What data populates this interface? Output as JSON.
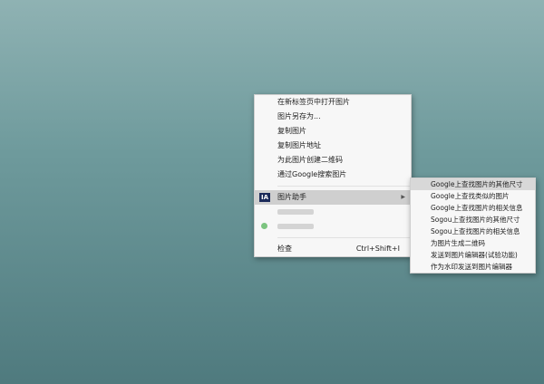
{
  "context_menu": {
    "items": [
      {
        "label": "在新标签页中打开图片"
      },
      {
        "label": "图片另存为..."
      },
      {
        "label": "复制图片"
      },
      {
        "label": "复制图片地址"
      },
      {
        "label": "为此图片创建二维码"
      },
      {
        "label": "通过Google搜索图片"
      }
    ],
    "extension_item": {
      "icon_text": "IA",
      "label": "图片助手",
      "icon": "image-assistant-icon"
    },
    "blurred_items": [
      {
        "label": ""
      },
      {
        "label": ""
      }
    ],
    "inspect": {
      "label": "检查",
      "shortcut": "Ctrl+Shift+I"
    }
  },
  "submenu": {
    "items": [
      {
        "label": "Google上查找图片的其他尺寸"
      },
      {
        "label": "Google上查找类似的图片"
      },
      {
        "label": "Google上查找图片的相关信息"
      },
      {
        "label": "Sogou上查找图片的其他尺寸"
      },
      {
        "label": "Sogou上查找图片的相关信息"
      },
      {
        "label": "为图片生成二维码"
      },
      {
        "label": "发送到图片编辑器(试验功能)"
      },
      {
        "label": "作为水印发送到图片编辑器"
      }
    ]
  },
  "colors": {
    "menu_bg": "#f7f7f7",
    "highlight": "#cfcfcf",
    "ia_icon_bg": "#1b2a59"
  }
}
